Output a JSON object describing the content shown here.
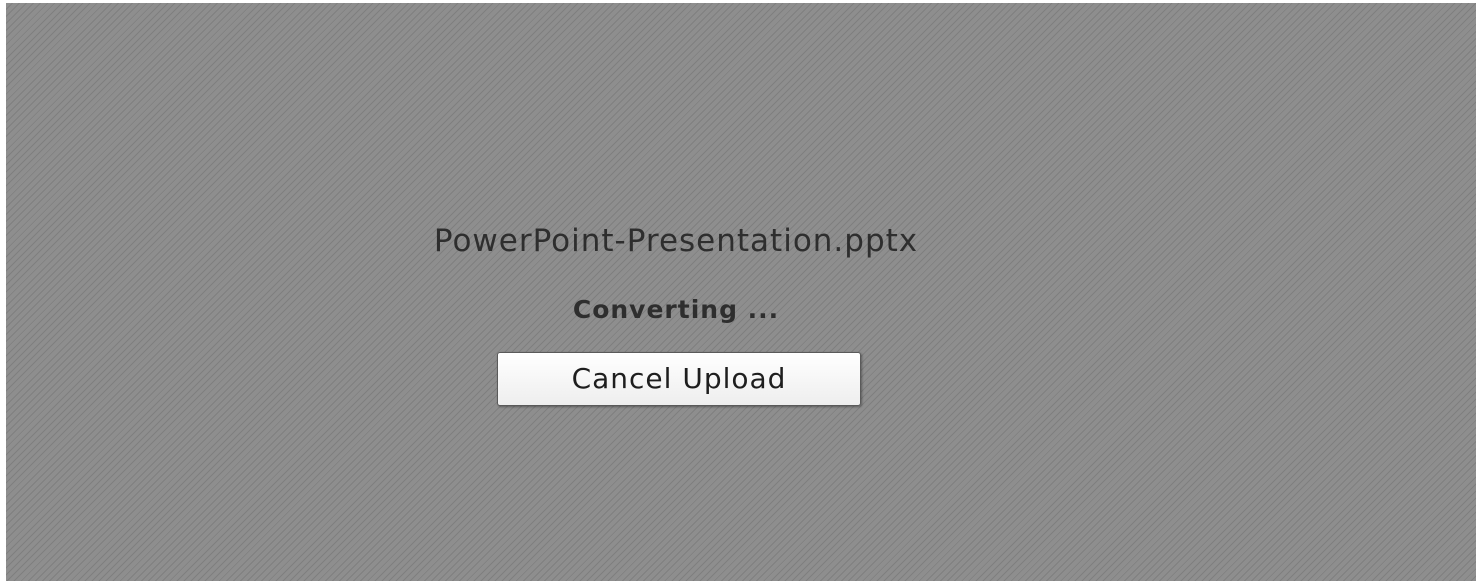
{
  "upload": {
    "file_name": "PowerPoint-Presentation.pptx",
    "status": "Converting ...",
    "cancel_label": "Cancel Upload"
  },
  "colors": {
    "background": "#8a8a8a",
    "text": "#2e2e2e",
    "button_background": "#ffffff"
  }
}
